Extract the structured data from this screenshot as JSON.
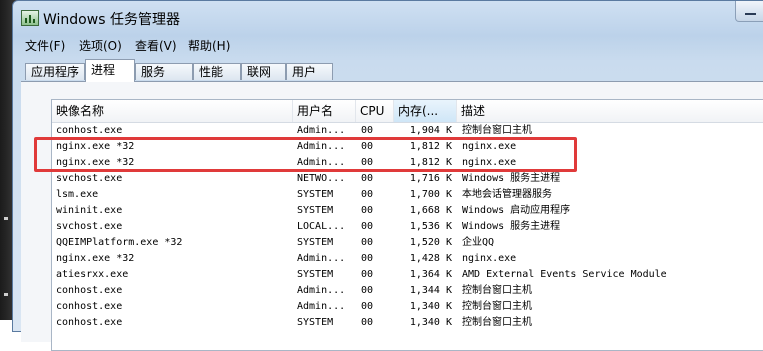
{
  "window": {
    "title": "Windows 任务管理器"
  },
  "menu": [
    "文件(F)",
    "选项(O)",
    "查看(V)",
    "帮助(H)"
  ],
  "tabs": [
    "应用程序",
    "进程",
    "服务",
    "性能",
    "联网",
    "用户"
  ],
  "active_tab": "进程",
  "columns": {
    "name": "映像名称",
    "user": "用户名",
    "cpu": "CPU",
    "mem": "内存(...",
    "desc": "描述"
  },
  "rows": [
    {
      "name": "conhost.exe",
      "user": "Admin...",
      "cpu": "00",
      "mem": "1,904 K",
      "desc": "控制台窗口主机"
    },
    {
      "name": "nginx.exe *32",
      "user": "Admin...",
      "cpu": "00",
      "mem": "1,812 K",
      "desc": "nginx.exe"
    },
    {
      "name": "nginx.exe *32",
      "user": "Admin...",
      "cpu": "00",
      "mem": "1,812 K",
      "desc": "nginx.exe"
    },
    {
      "name": "svchost.exe",
      "user": "NETWO...",
      "cpu": "00",
      "mem": "1,716 K",
      "desc": "Windows 服务主进程"
    },
    {
      "name": "lsm.exe",
      "user": "SYSTEM",
      "cpu": "00",
      "mem": "1,700 K",
      "desc": "本地会话管理器服务"
    },
    {
      "name": "wininit.exe",
      "user": "SYSTEM",
      "cpu": "00",
      "mem": "1,668 K",
      "desc": "Windows 启动应用程序"
    },
    {
      "name": "svchost.exe",
      "user": "LOCAL...",
      "cpu": "00",
      "mem": "1,536 K",
      "desc": "Windows 服务主进程"
    },
    {
      "name": "QQEIMPlatform.exe *32",
      "user": "SYSTEM",
      "cpu": "00",
      "mem": "1,520 K",
      "desc": "企业QQ"
    },
    {
      "name": "nginx.exe *32",
      "user": "Admin...",
      "cpu": "00",
      "mem": "1,428 K",
      "desc": "nginx.exe"
    },
    {
      "name": "atiesrxx.exe",
      "user": "SYSTEM",
      "cpu": "00",
      "mem": "1,364 K",
      "desc": "AMD External Events Service Module"
    },
    {
      "name": "conhost.exe",
      "user": "Admin...",
      "cpu": "00",
      "mem": "1,344 K",
      "desc": "控制台窗口主机"
    },
    {
      "name": "conhost.exe",
      "user": "Admin...",
      "cpu": "00",
      "mem": "1,340 K",
      "desc": "控制台窗口主机"
    },
    {
      "name": "conhost.exe",
      "user": "SYSTEM",
      "cpu": "00",
      "mem": "1,340 K",
      "desc": "控制台窗口主机"
    }
  ],
  "highlight": {
    "color": "#e03a3a"
  }
}
